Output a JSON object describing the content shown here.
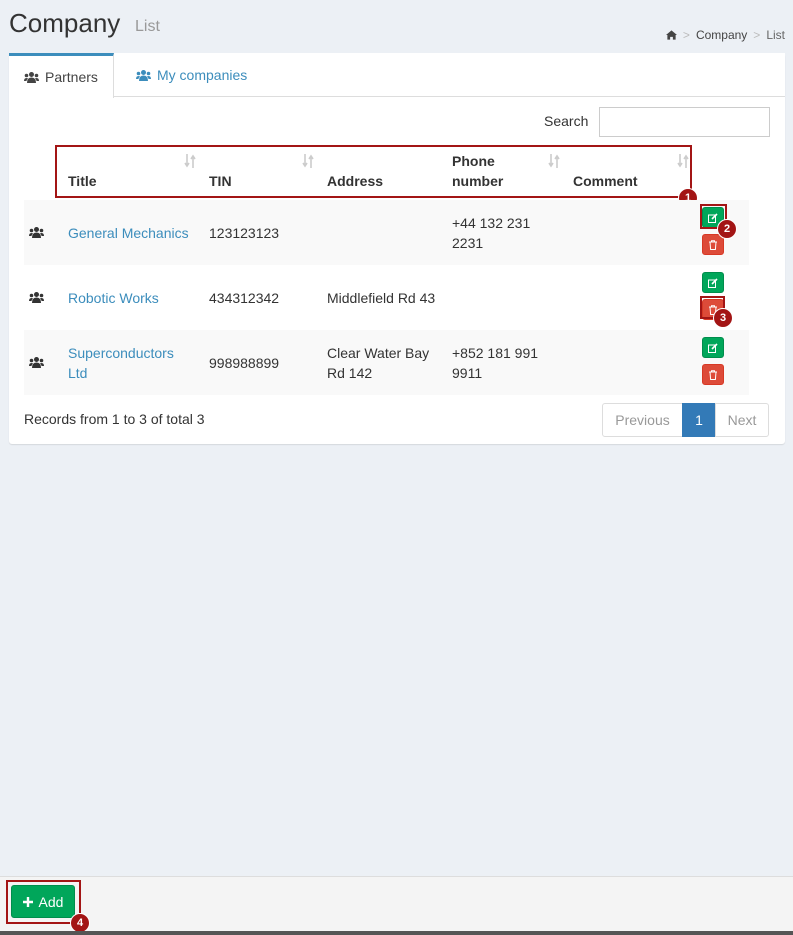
{
  "header": {
    "title": "Company",
    "subtitle": "List",
    "breadcrumb": {
      "home_icon": "home-icon",
      "items": [
        "Company",
        "List"
      ],
      "separator": ">"
    }
  },
  "tabs": [
    {
      "label": "Partners",
      "icon": "users-icon",
      "active": true
    },
    {
      "label": "My companies",
      "icon": "users-icon",
      "active": false
    }
  ],
  "search": {
    "label": "Search",
    "value": "",
    "placeholder": ""
  },
  "table": {
    "columns": [
      {
        "label": "Title",
        "sortable": true
      },
      {
        "label": "TIN",
        "sortable": true
      },
      {
        "label": "Address",
        "sortable": false
      },
      {
        "label": "Phone number",
        "sortable": true
      },
      {
        "label": "Comment",
        "sortable": true
      }
    ],
    "rows": [
      {
        "title": "General Mechanics",
        "tin": "123123123",
        "address": "",
        "phone": "+44 132 231 2231",
        "comment": ""
      },
      {
        "title": "Robotic Works",
        "tin": "434312342",
        "address": "Middlefield Rd 43",
        "phone": "",
        "comment": ""
      },
      {
        "title": "Superconductors Ltd",
        "tin": "998988899",
        "address": "Clear Water Bay Rd 142",
        "phone": "+852 181 991 9911",
        "comment": ""
      }
    ]
  },
  "pagination": {
    "records_text": "Records from 1 to 3 of total 3",
    "previous": "Previous",
    "current": "1",
    "next": "Next"
  },
  "footer": {
    "add_label": "Add"
  },
  "annotations": [
    "1",
    "2",
    "3",
    "4"
  ],
  "colors": {
    "accent": "#3c8dbc",
    "success": "#00a65a",
    "danger": "#dd4b39",
    "annotation": "#a31515"
  }
}
